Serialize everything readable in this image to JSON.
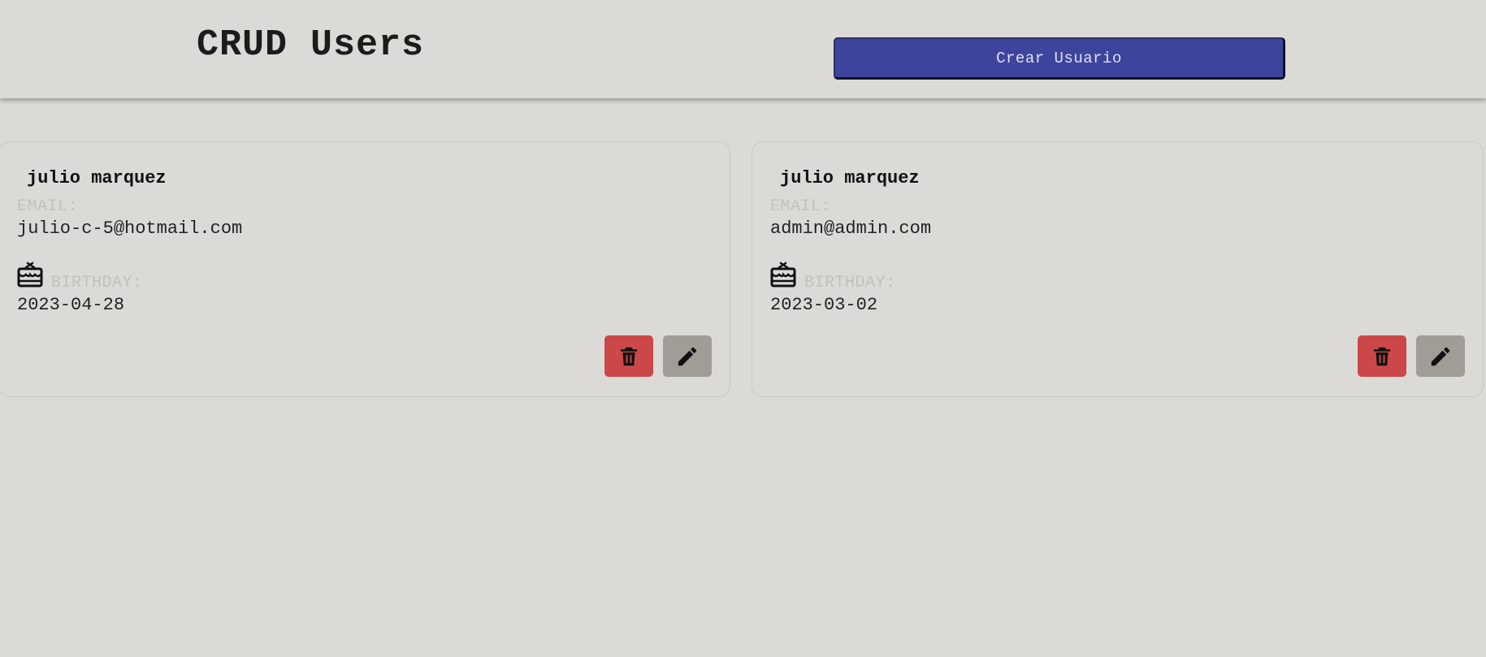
{
  "header": {
    "title": "CRUD Users",
    "create_label": "Crear Usuario"
  },
  "labels": {
    "email": "EMAIL:",
    "birthday": "BIRTHDAY:"
  },
  "users": [
    {
      "name": "julio marquez",
      "email": "julio-c-5@hotmail.com",
      "birthday": "2023-04-28"
    },
    {
      "name": "julio marquez",
      "email": "admin@admin.com",
      "birthday": "2023-03-02"
    }
  ],
  "icons": {
    "birthday": "cake-icon",
    "delete": "trash-icon",
    "edit": "pencil-icon"
  },
  "colors": {
    "background": "#dcdad6",
    "primary": "#3d449b",
    "danger": "#cc4848",
    "secondary": "#a09d97"
  }
}
